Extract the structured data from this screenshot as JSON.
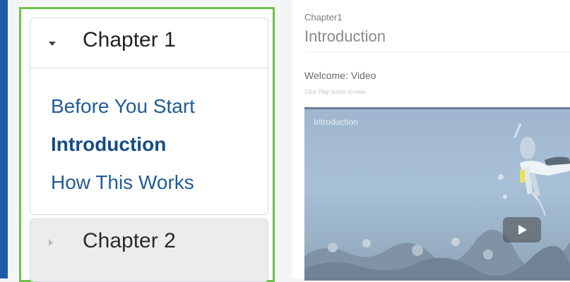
{
  "sidebar": {
    "chapters": [
      {
        "title": "Chapter 1",
        "expanded": true,
        "lessons": [
          {
            "label": "Before You Start",
            "active": false
          },
          {
            "label": "Introduction",
            "active": true
          },
          {
            "label": "How This Works",
            "active": false
          }
        ]
      },
      {
        "title": "Chapter 2",
        "expanded": false,
        "lessons": []
      }
    ]
  },
  "main": {
    "breadcrumb": "Chapter1",
    "page_title": "Introduction",
    "section_title": "Welcome: Video",
    "hint": "Click Play button to view.",
    "video": {
      "title": "Introduction",
      "play_icon": "play-icon"
    }
  },
  "colors": {
    "highlight_border": "#6ec04a",
    "link": "#215c97",
    "left_bar": "#1f5aa6"
  }
}
